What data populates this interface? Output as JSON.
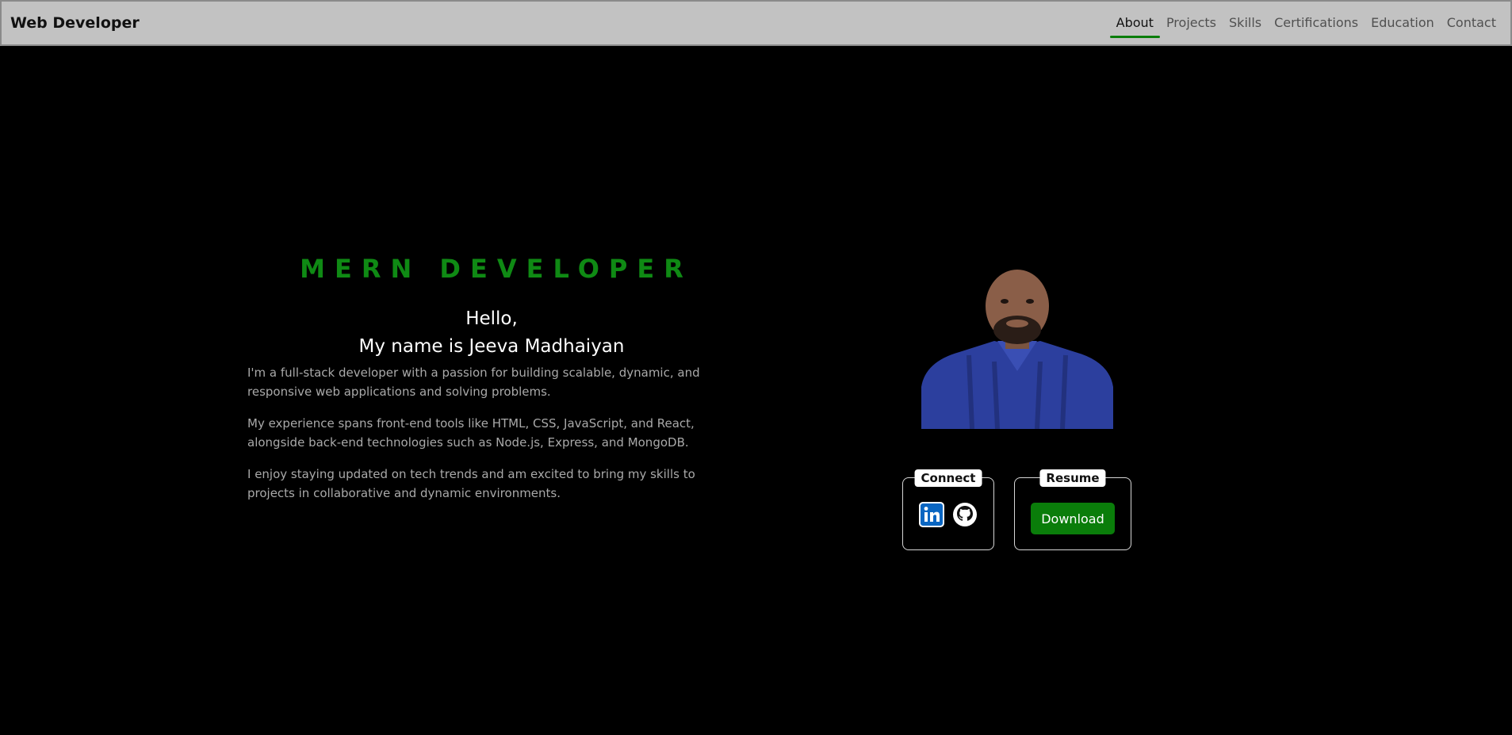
{
  "navbar": {
    "brand": "Web Developer",
    "links": [
      {
        "label": "About",
        "active": true
      },
      {
        "label": "Projects"
      },
      {
        "label": "Skills"
      },
      {
        "label": "Certifications"
      },
      {
        "label": "Education"
      },
      {
        "label": "Contact"
      }
    ]
  },
  "hero": {
    "role": "MERN DEVELOPER",
    "greeting_line1": "Hello,",
    "greeting_line2": "My name is Jeeva Madhaiyan",
    "paragraphs": [
      "I'm a full-stack developer with a passion for building scalable, dynamic, and responsive web applications and solving problems.",
      "My experience spans front-end tools like HTML, CSS, JavaScript, and React, alongside back-end technologies such as Node.js, Express, and MongoDB.",
      "I enjoy staying updated on tech trends and am excited to bring my skills to projects in collaborative and dynamic environments."
    ]
  },
  "connect": {
    "label": "Connect",
    "icons": [
      "linkedin-icon",
      "github-icon"
    ]
  },
  "resume": {
    "label": "Resume",
    "button_label": "Download"
  },
  "colors": {
    "accent_green": "#0f8a14",
    "button_green": "#0a7d0a",
    "navbar_bg": "#c2c2c2",
    "page_bg": "#000000",
    "body_text": "#a9a9a9",
    "shirt_blue": "#2c3f9e"
  }
}
